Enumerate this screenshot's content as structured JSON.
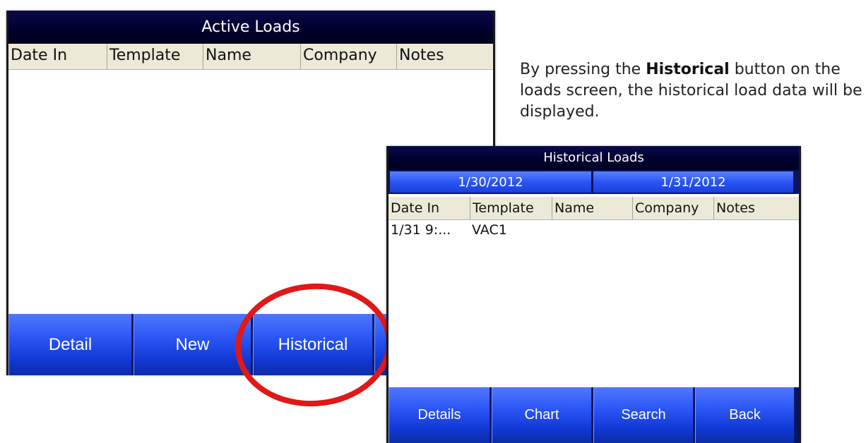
{
  "active_loads": {
    "title": "Active Loads",
    "columns": [
      "Date In",
      "Template",
      "Name",
      "Company",
      "Notes"
    ],
    "buttons": [
      "Detail",
      "New",
      "Historical"
    ]
  },
  "caption": {
    "before": "By pressing the ",
    "highlight": "Historical",
    "after": " button on the loads screen, the historical load data will be displayed."
  },
  "historical_loads": {
    "title": "Historical Loads",
    "date_from": "1/30/2012",
    "date_to": "1/31/2012",
    "columns": [
      "Date In",
      "Template",
      "Name",
      "Company",
      "Notes"
    ],
    "rows": [
      {
        "date_in": "1/31 9:...",
        "template": "VAC1",
        "name": "",
        "company": "",
        "notes": ""
      }
    ],
    "buttons": [
      "Details",
      "Chart",
      "Search",
      "Back"
    ]
  },
  "colors": {
    "title_bar": "#000030",
    "button_blue": "#2a55f4",
    "header_gray": "#ece9d8",
    "annotation_red": "#e01818"
  }
}
